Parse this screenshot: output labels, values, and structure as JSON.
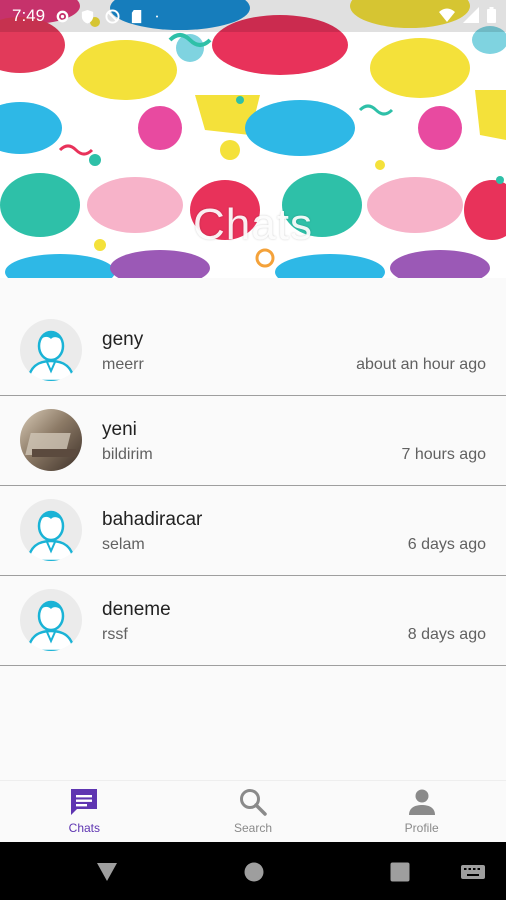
{
  "status_bar": {
    "time": "7:49"
  },
  "header": {
    "title": "Chats"
  },
  "chats": [
    {
      "name": "geny",
      "last_message": "meerr",
      "time": "about an hour ago",
      "avatar": "default-avatar"
    },
    {
      "name": "yeni",
      "last_message": "bildirim",
      "time": "7 hours ago",
      "avatar": "photo-avatar"
    },
    {
      "name": "bahadiracar",
      "last_message": "selam",
      "time": "6 days ago",
      "avatar": "default-avatar"
    },
    {
      "name": "deneme",
      "last_message": "rssf",
      "time": "8 days ago",
      "avatar": "default-avatar"
    }
  ],
  "bottom_nav": {
    "items": [
      {
        "label": "Chats",
        "icon": "chat-icon",
        "active": true
      },
      {
        "label": "Search",
        "icon": "search-icon",
        "active": false
      },
      {
        "label": "Profile",
        "icon": "profile-icon",
        "active": false
      }
    ]
  },
  "colors": {
    "accent": "#5e35b1",
    "avatar_blue": "#1ab3d6",
    "divider": "#9e9e9e"
  }
}
